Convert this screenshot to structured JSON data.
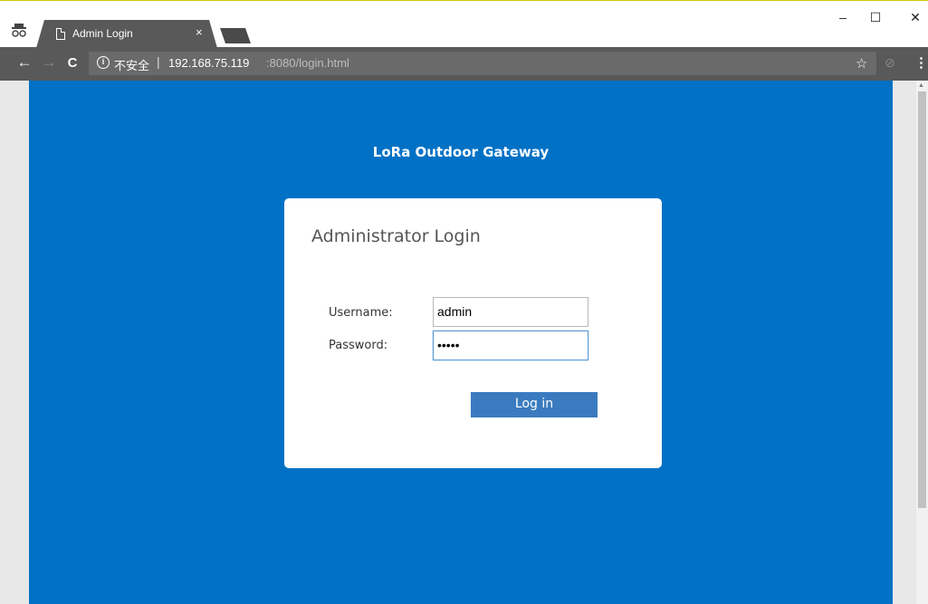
{
  "browser": {
    "tab_title": "Admin Login",
    "tab_close": "×",
    "window": {
      "minimize": "–",
      "maximize": "☐",
      "close": "✕"
    },
    "nav": {
      "back": "←",
      "forward": "→",
      "reload": "C"
    },
    "address": {
      "info_symbol": "i",
      "security_label": "不安全",
      "separator": "|",
      "host": "192.168.75.119",
      "rest": ":8080/login.html"
    },
    "icons": {
      "star": "☆",
      "extension": "⊘",
      "menu": "⋮"
    }
  },
  "page": {
    "brand": "LoRa Outdoor Gateway",
    "login": {
      "title": "Administrator Login",
      "username_label": "Username:",
      "username_value": "admin",
      "password_label": "Password:",
      "password_value": "•••••",
      "submit_label": "Log in"
    }
  },
  "colors": {
    "page_background": "#0071c5",
    "button": "#3a7bbf",
    "browser_chrome": "#595959"
  }
}
